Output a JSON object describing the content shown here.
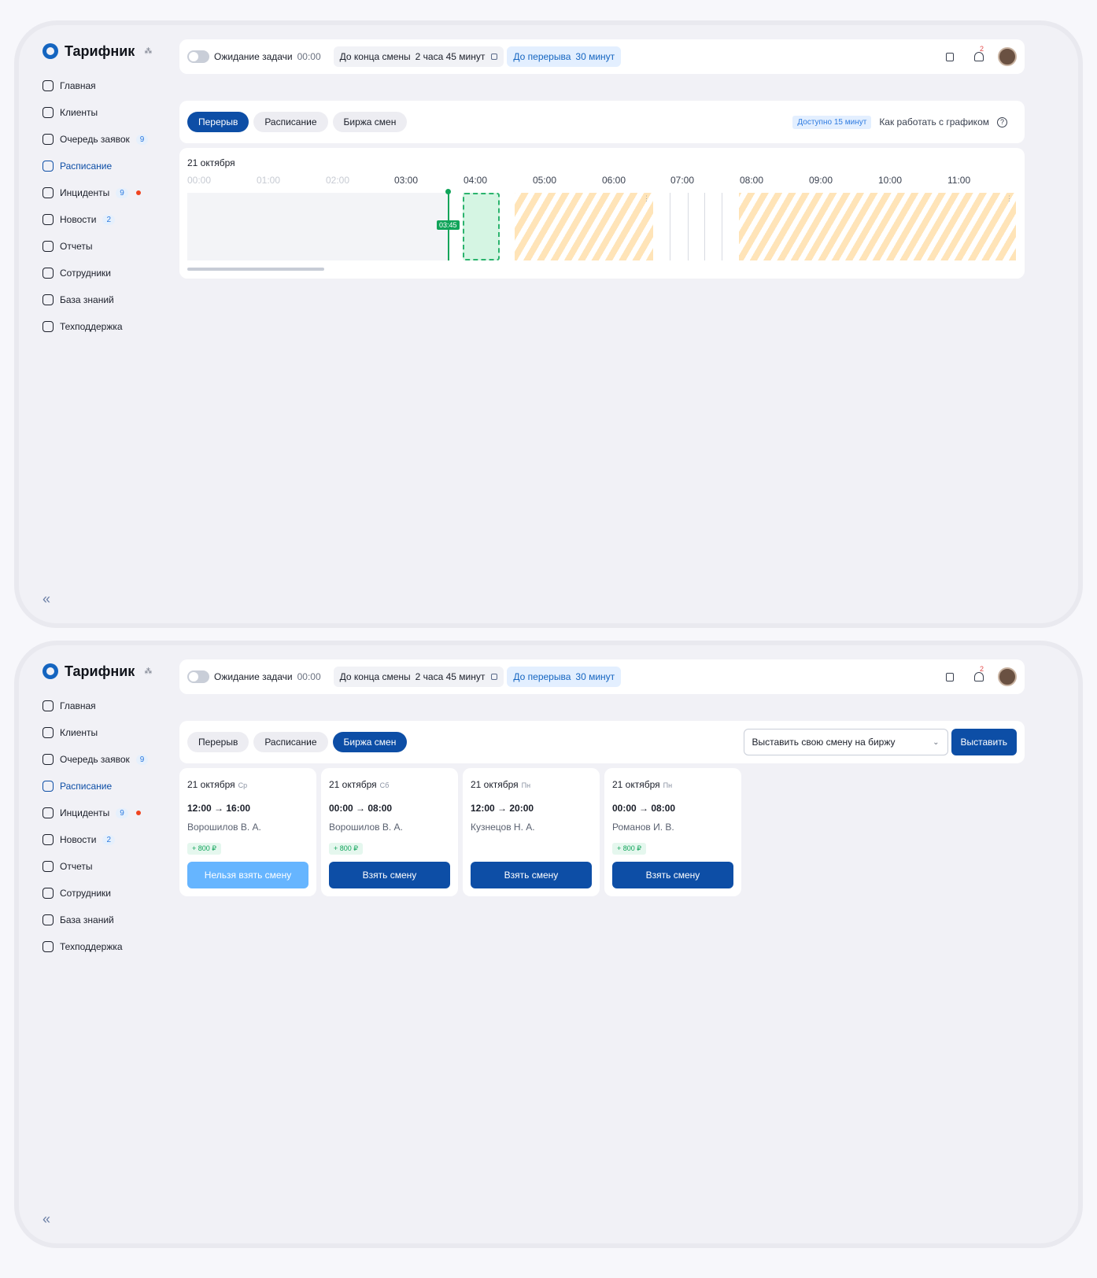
{
  "app": {
    "name": "Тарифник",
    "brand_icon": "tarifnik-logo-icon",
    "switch_icon": "org-switch-icon"
  },
  "nav": [
    {
      "label": "Главная",
      "icon": "home-icon"
    },
    {
      "label": "Клиенты",
      "icon": "clients-icon"
    },
    {
      "label": "Очередь заявок",
      "icon": "queue-icon",
      "badge": "9"
    },
    {
      "label": "Расписание",
      "icon": "calendar-icon",
      "active": true
    },
    {
      "label": "Инциденты",
      "icon": "incidents-icon",
      "badge": "9",
      "dot": true
    },
    {
      "label": "Новости",
      "icon": "news-icon",
      "badge": "2"
    },
    {
      "label": "Отчеты",
      "icon": "reports-icon"
    },
    {
      "label": "Сотрудники",
      "icon": "employees-icon"
    },
    {
      "label": "База знаний",
      "icon": "knowledge-icon"
    },
    {
      "label": "Техподдержка",
      "icon": "support-icon"
    }
  ],
  "collapse_icon": "«",
  "topbar": {
    "wait_label": "Ожидание задачи",
    "wait_time": "00:00",
    "shift_end_label": "До конца смены",
    "shift_end_value": "2 часа 45 минут",
    "break_label": "До перерыва",
    "break_value": "30 минут",
    "notifications_count": "2"
  },
  "tabs": [
    "Перерыв",
    "Расписание",
    "Биржа смен"
  ],
  "screen1": {
    "active_tab": 0,
    "available": "Доступно 15 минут",
    "howto": "Как работать с графиком",
    "help_glyph": "?",
    "date": "21 октября",
    "hours": [
      "00:00",
      "01:00",
      "02:00",
      "03:00",
      "04:00",
      "05:00",
      "06:00",
      "07:00",
      "08:00",
      "09:00",
      "10:00",
      "11:00"
    ],
    "now_label": "03:45"
  },
  "screen2": {
    "active_tab": 2,
    "select_value": "Выставить свою смену на биржу",
    "submit": "Выставить",
    "cards": [
      {
        "date": "21 октября",
        "day": "Ср",
        "time": "12:00 → 16:00",
        "name": "Ворошилов В. А.",
        "bonus": "+ 800 ₽",
        "button": "Нельзя взять смену",
        "disabled": true
      },
      {
        "date": "21 октября",
        "day": "Сб",
        "time": "00:00 → 08:00",
        "name": "Ворошилов В. А.",
        "bonus": "+ 800 ₽",
        "button": "Взять смену",
        "disabled": false
      },
      {
        "date": "21 октября",
        "day": "Пн",
        "time": "12:00 → 20:00",
        "name": "Кузнецов Н. А.",
        "bonus": "",
        "button": "Взять смену",
        "disabled": false
      },
      {
        "date": "21 октября",
        "day": "Пн",
        "time": "00:00 → 08:00",
        "name": "Романов И. В.",
        "bonus": "+ 800 ₽",
        "button": "Взять смену",
        "disabled": false
      }
    ]
  },
  "colors": {
    "accent": "#0d4ea6",
    "green": "#11a45a",
    "hatch": "#ffe4b8",
    "alert": "#f0441f"
  }
}
